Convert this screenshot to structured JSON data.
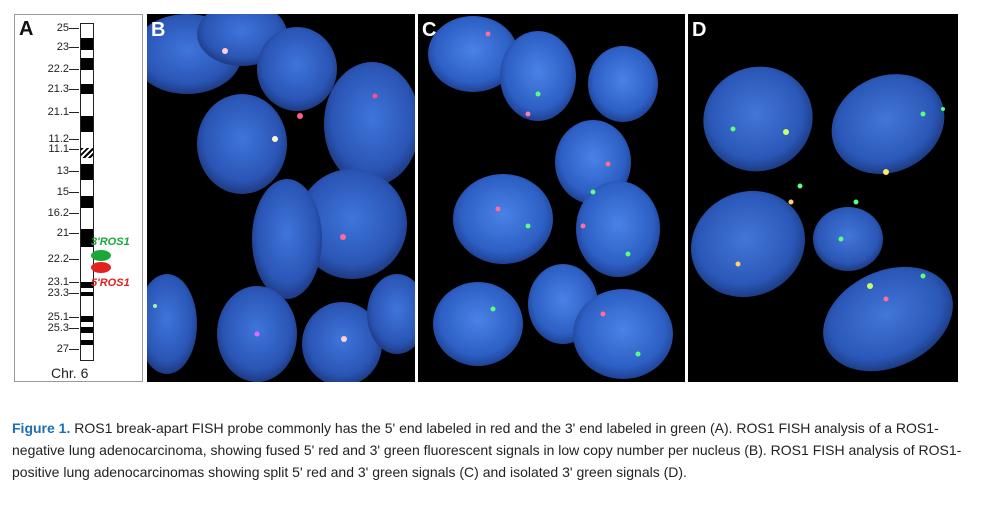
{
  "panel_a": {
    "label": "A",
    "bands": [
      "25",
      "23",
      "22.2",
      "21.3",
      "21.1",
      "11.2",
      "11.1",
      "13",
      "15",
      "16.2",
      "21",
      "22.2",
      "23.1",
      "23.3",
      "25.1",
      "25.3",
      "27"
    ],
    "probe_3prime": "3'ROS1",
    "probe_5prime": "5'ROS1",
    "chromosome_label": "Chr. 6"
  },
  "panels": [
    {
      "label": "B"
    },
    {
      "label": "C"
    },
    {
      "label": "D"
    }
  ],
  "caption": {
    "figure_label": "Figure 1.",
    "text": " ROS1 break-apart  FISH probe commonly has the 5' end labeled in red and the 3' end labeled in green (A). ROS1 FISH analysis of a ROS1-negative lung adenocarcinoma, showing fused 5' red and 3' green fluorescent signals in low copy number per nucleus (B). ROS1 FISH analysis of ROS1-positive lung adenocarcinomas showing split 5' red and 3' green signals (C) and isolated 3' green signals (D)."
  },
  "colors": {
    "caption_label": "#1f6fb2",
    "probe_green": "#1aa83a",
    "probe_red": "#e0231f",
    "nucleus_blue": "#2d5fc4"
  }
}
